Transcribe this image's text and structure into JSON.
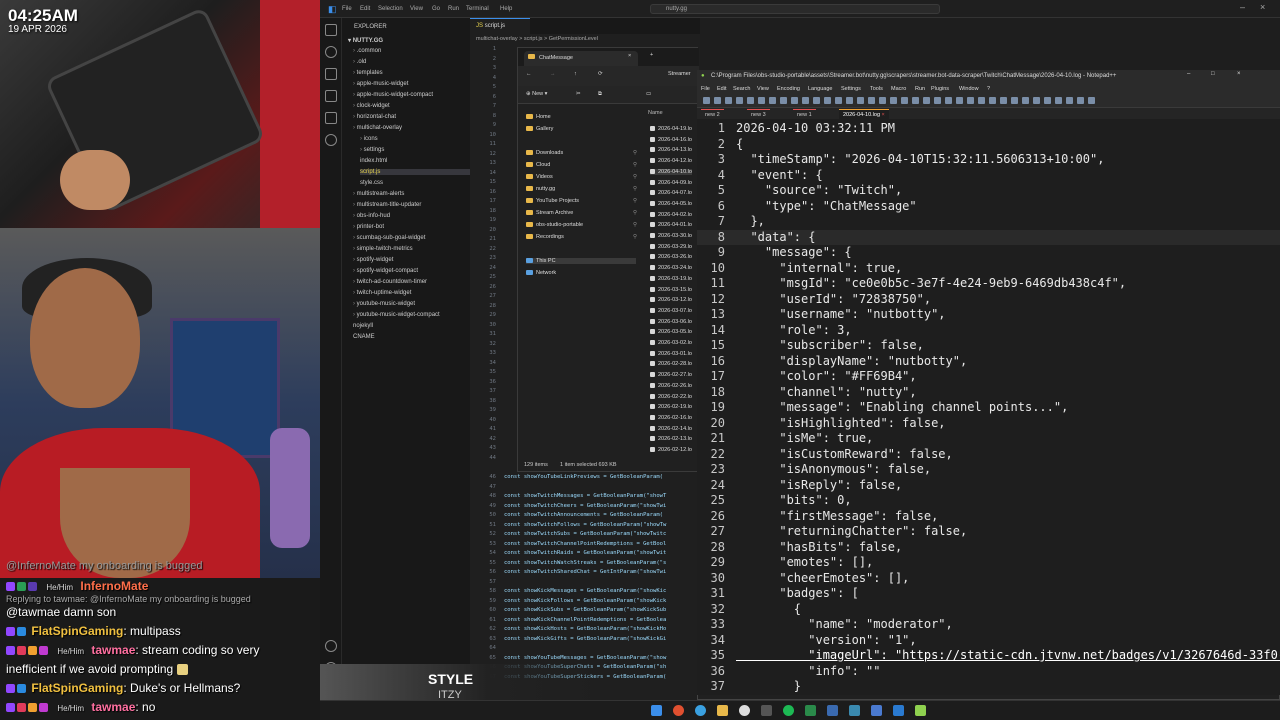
{
  "overlay": {
    "clock": "04:25AM",
    "date": "19 APR 2026"
  },
  "chat": {
    "lines": [
      {
        "text": "@InfernoMate my onboarding is bugged"
      },
      {
        "user": "InfernoMate",
        "pronoun": "He/Him",
        "text": ""
      },
      {
        "reply": "Replying to tawmae: @InfernoMate my onboarding is bugged"
      },
      {
        "text": "@tawmae damn son"
      },
      {
        "user": "FlatSpinGaming",
        "text": ": multipass"
      },
      {
        "user": "tawmae",
        "pronoun": "He/Him",
        "text": ": stream coding so very"
      },
      {
        "text": "inefficient if we avoid prompting"
      },
      {
        "user": "FlatSpinGaming",
        "text": ": Duke's or Hellmans?"
      },
      {
        "user": "tawmae",
        "pronoun": "He/Him",
        "text": ": no"
      }
    ],
    "colors": {
      "flatspin": "#f0c040",
      "tawmae": "#ff6fa0",
      "inferno": "#ff6f4a"
    }
  },
  "media": {
    "title": "STYLE",
    "artist": "ITZY"
  },
  "vscode": {
    "menu": [
      "File",
      "Edit",
      "Selection",
      "View",
      "Go",
      "Run",
      "Terminal",
      "Help"
    ],
    "search": "nutty.gg",
    "explorer_title": "EXPLORER",
    "root": "NUTTY.GG",
    "tree": [
      {
        "label": ".common",
        "depth": 1,
        "type": "folder"
      },
      {
        "label": ".old",
        "depth": 1,
        "type": "folder"
      },
      {
        "label": "templates",
        "depth": 1,
        "type": "folder"
      },
      {
        "label": "apple-music-widget",
        "depth": 1,
        "type": "folder"
      },
      {
        "label": "apple-music-widget-compact",
        "depth": 1,
        "type": "folder"
      },
      {
        "label": "clock-widget",
        "depth": 1,
        "type": "folder"
      },
      {
        "label": "horizontal-chat",
        "depth": 1,
        "type": "folder"
      },
      {
        "label": "multichat-overlay",
        "depth": 1,
        "type": "folder"
      },
      {
        "label": "icons",
        "depth": 2,
        "type": "folder"
      },
      {
        "label": "settings",
        "depth": 2,
        "type": "folder"
      },
      {
        "label": "index.html",
        "depth": 2,
        "type": "file"
      },
      {
        "label": "script.js",
        "depth": 2,
        "type": "file",
        "selected": true
      },
      {
        "label": "style.css",
        "depth": 2,
        "type": "file"
      },
      {
        "label": "multistream-alerts",
        "depth": 1,
        "type": "folder"
      },
      {
        "label": "multistream-title-updater",
        "depth": 1,
        "type": "folder"
      },
      {
        "label": "obs-info-hud",
        "depth": 1,
        "type": "folder"
      },
      {
        "label": "printer-bot",
        "depth": 1,
        "type": "folder"
      },
      {
        "label": "scumbag-sub-goal-widget",
        "depth": 1,
        "type": "folder"
      },
      {
        "label": "simple-twitch-metrics",
        "depth": 1,
        "type": "folder"
      },
      {
        "label": "spotify-widget",
        "depth": 1,
        "type": "folder"
      },
      {
        "label": "spotify-widget-compact",
        "depth": 1,
        "type": "folder"
      },
      {
        "label": "twitch-ad-countdown-timer",
        "depth": 1,
        "type": "folder"
      },
      {
        "label": "twitch-uptime-widget",
        "depth": 1,
        "type": "folder"
      },
      {
        "label": "youtube-music-widget",
        "depth": 1,
        "type": "folder"
      },
      {
        "label": "youtube-music-widget-compact",
        "depth": 1,
        "type": "folder"
      },
      {
        "label": "nojekyll",
        "depth": 1,
        "type": "file"
      },
      {
        "label": "CNAME",
        "depth": 1,
        "type": "file"
      }
    ],
    "editor_tab": "script.js",
    "breadcrumb": "multichat-overlay > script.js > GetPermissionLevel",
    "code_lines": [
      {
        "n": 46,
        "text": "const showYouTubeLinkPreviews = GetBooleanParam("
      },
      {
        "n": 47,
        "text": ""
      },
      {
        "n": 48,
        "text": "const showTwitchMessages = GetBooleanParam(\"showT"
      },
      {
        "n": 49,
        "text": "const showTwitchCheers = GetBooleanParam(\"showTwi"
      },
      {
        "n": 50,
        "text": "const showTwitchAnnouncements = GetBooleanParam("
      },
      {
        "n": 51,
        "text": "const showTwitchFollows = GetBooleanParam(\"showTw"
      },
      {
        "n": 52,
        "text": "const showTwitchSubs = GetBooleanParam(\"showTwitc"
      },
      {
        "n": 53,
        "text": "const showTwitchChannelPointRedemptions = GetBool"
      },
      {
        "n": 54,
        "text": "const showTwitchRaids = GetBooleanParam(\"showTwit"
      },
      {
        "n": 55,
        "text": "const showTwitchWatchStreaks = GetBooleanParam(\"s"
      },
      {
        "n": 56,
        "text": "const showTwitchSharedChat = GetIntParam(\"showTwi"
      },
      {
        "n": 57,
        "text": ""
      },
      {
        "n": 58,
        "text": "const showKickMessages = GetBooleanParam(\"showKic"
      },
      {
        "n": 59,
        "text": "const showKickFollows = GetBooleanParam(\"showKick"
      },
      {
        "n": 60,
        "text": "const showKickSubs = GetBooleanParam(\"showKickSub"
      },
      {
        "n": 61,
        "text": "const showKickChannelPointRedemptions = GetBoolea"
      },
      {
        "n": 62,
        "text": "const showKickHosts = GetBooleanParam(\"showKickHo"
      },
      {
        "n": 63,
        "text": "const showKickGifts = GetBooleanParam(\"showKickGi"
      },
      {
        "n": 64,
        "text": ""
      },
      {
        "n": 65,
        "text": "const showYouTubeMessages = GetBooleanParam(\"show"
      },
      {
        "n": 66,
        "text": "const showYouTubeSuperChats = GetBooleanParam(\"sh"
      },
      {
        "n": 67,
        "text": "const showYouTubeSuperStickers = GetBooleanParam("
      }
    ]
  },
  "file_explorer": {
    "tab": "ChatMessage",
    "address": "Streamer",
    "new_label": "New",
    "column_name": "Name",
    "nav": [
      {
        "label": "Home"
      },
      {
        "label": "Gallery"
      },
      {
        "label": "Downloads",
        "pinned": true
      },
      {
        "label": "Cloud",
        "pinned": true
      },
      {
        "label": "Videos",
        "pinned": true
      },
      {
        "label": "nutty.gg",
        "pinned": true
      },
      {
        "label": "YouTube Projects",
        "pinned": true
      },
      {
        "label": "Stream Archive",
        "pinned": true
      },
      {
        "label": "obs-studio-portable",
        "pinned": true
      },
      {
        "label": "Recordings",
        "pinned": true
      },
      {
        "label": "This PC"
      },
      {
        "label": "Network"
      }
    ],
    "files": [
      "2026-04-19.lo",
      "2026-04-16.lo",
      "2026-04-13.lo",
      "2026-04-12.lo",
      "2026-04-10.lo",
      "2026-04-09.lo",
      "2026-04-07.lo",
      "2026-04-05.lo",
      "2026-04-02.lo",
      "2026-04-01.lo",
      "2026-03-30.lo",
      "2026-03-29.lo",
      "2026-03-26.lo",
      "2026-03-24.lo",
      "2026-03-19.lo",
      "2026-03-15.lo",
      "2026-03-12.lo",
      "2026-03-07.lo",
      "2026-03-06.lo",
      "2026-03-05.lo",
      "2026-03-02.lo",
      "2026-03-01.lo",
      "2026-02-28.lo",
      "2026-02-27.lo",
      "2026-02-26.lo",
      "2026-02-22.lo",
      "2026-02-19.lo",
      "2026-02-16.lo",
      "2026-02-14.lo",
      "2026-02-13.lo",
      "2026-02-12.lo"
    ],
    "status_items": "129 items",
    "status_selected": "1 item selected  693 KB"
  },
  "notepad": {
    "title": "C:\\Program Files\\obs-studio-portable\\assets\\Streamer.bot\\nutty.gg\\scrapers\\streamer.bot-data-scraper\\Twitch\\ChatMessage\\2026-04-10.log - Notepad++",
    "menu": [
      "File",
      "Edit",
      "Search",
      "View",
      "Encoding",
      "Language",
      "Settings",
      "Tools",
      "Macro",
      "Run",
      "Plugins",
      "Window",
      "?"
    ],
    "tabs": [
      "new 2",
      "new 3",
      "new 1",
      "2026-04-10.log"
    ],
    "lines": [
      "2026-04-10 03:32:11 PM",
      "{",
      "  \"timeStamp\": \"2026-04-10T15:32:11.5606313+10:00\",",
      "  \"event\": {",
      "    \"source\": \"Twitch\",",
      "    \"type\": \"ChatMessage\"",
      "  },",
      "  \"data\": {",
      "    \"message\": {",
      "      \"internal\": true,",
      "      \"msgId\": \"ce0e0b5c-3e7f-4e24-9eb9-6469db438c4f\",",
      "      \"userId\": \"72838750\",",
      "      \"username\": \"nutbotty\",",
      "      \"role\": 3,",
      "      \"subscriber\": false,",
      "      \"displayName\": \"nutbotty\",",
      "      \"color\": \"#FF69B4\",",
      "      \"channel\": \"nutty\",",
      "      \"message\": \"Enabling channel points...\",",
      "      \"isHighlighted\": false,",
      "      \"isMe\": true,",
      "      \"isCustomReward\": false,",
      "      \"isAnonymous\": false,",
      "      \"isReply\": false,",
      "      \"bits\": 0,",
      "      \"firstMessage\": false,",
      "      \"returningChatter\": false,",
      "      \"hasBits\": false,",
      "      \"emotes\": [],",
      "      \"cheerEmotes\": [],",
      "      \"badges\": [",
      "        {",
      "          \"name\": \"moderator\",",
      "          \"version\": \"1\",",
      "          \"imageUrl\": \"https://static-cdn.jtvnw.net/badges/v1/3267646d-33f0-4b",
      "          \"info\": \"\"",
      "        }"
    ]
  }
}
